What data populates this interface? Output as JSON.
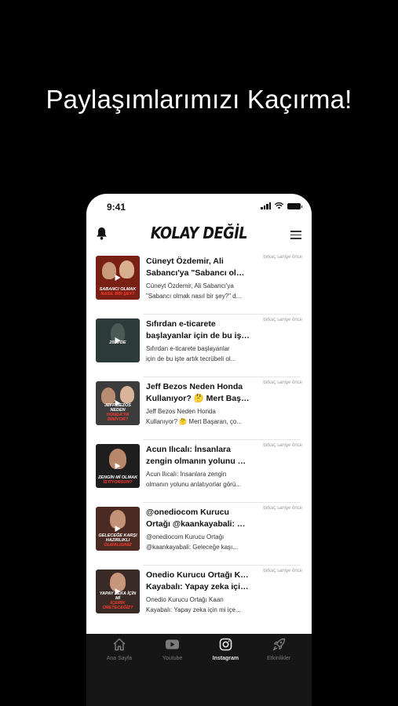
{
  "headline": "Paylaşımlarımızı Kaçırma!",
  "status": {
    "time": "9:41"
  },
  "app": {
    "logo": "KOLAY DEĞİL"
  },
  "icons": {
    "bell": "bell-icon",
    "menu": "hamburger-menu-icon"
  },
  "feed": [
    {
      "title1": "Cüneyt Özdemir, Ali",
      "title2": "Sabancı'ya \"Sabancı olma...",
      "desc1": "Cüneyt Özdemir, Ali Sabancı'ya",
      "desc2": "\"Sabancı olmak nasıl bir şey?\" d...",
      "time": "birkaç saniye önce",
      "caption": "SABANCI OLMAK",
      "caption2": "NASIL BİR ŞEY?",
      "bg": "#7a1f14"
    },
    {
      "title1": "Sıfırdan e-ticarete",
      "title2": "başlayanlar için de bu işte...",
      "desc1": "Sıfırdan e-ticarete başlayanlar",
      "desc2": "için de bu işte artık tecrübeli ol...",
      "time": "birkaç saniye önce",
      "caption": "2020'DE",
      "caption2": "",
      "bg": "#2c3a3a"
    },
    {
      "title1": "Jeff Bezos Neden Honda",
      "title2": "Kullanıyor? 🤔 Mert Başar...",
      "desc1": "Jeff Bezos Neden Honda",
      "desc2": "Kullanıyor? 🤔 Mert Başaran, ço...",
      "time": "birkaç saniye önce",
      "caption": "JEFF BEZOS NEDEN",
      "caption2": "HONDA'YA BİNİYOR?",
      "bg": "#3c3c3c"
    },
    {
      "title1": "Acun Ilıcalı: İnsanlara",
      "title2": "zengin olmanın yolunu anl...",
      "desc1": "Acun Ilıcalı: İnsanlara zengin",
      "desc2": "olmanın yolunu anlatıyorlar görü...",
      "time": "birkaç saniye önce",
      "caption": "ZENGİN Mİ OLMAK",
      "caption2": "İSTİYORSUN?",
      "bg": "#1e1e1e"
    },
    {
      "title1": "@onediocom Kurucu",
      "title2": "Ortağı @kaankayabali: Ge...",
      "desc1": "@onediocom Kurucu Ortağı",
      "desc2": "@kaankayabali: Geleceğe kaşı...",
      "time": "birkaç saniye önce",
      "caption": "GELECEĞE KARŞI HAZIRLIKLI",
      "caption2": "OLMALISINIZ",
      "bg": "#4a2a22"
    },
    {
      "title1": "Onedio Kurucu Ortağı Kaan",
      "title2": "Kayabalı: Yapay zeka için...",
      "desc1": "Onedio Kurucu Ortağı Kaan",
      "desc2": "Kayabalı: Yapay zeka için mi içe...",
      "time": "birkaç saniye önce",
      "caption": "YAPAY ZEKA İÇİN Mİ",
      "caption2": "İÇERİK ÜRETECEĞİZ?",
      "bg": "#3a2a26"
    }
  ],
  "tabs": [
    {
      "label": "Ana Sayfa",
      "icon": "home-icon"
    },
    {
      "label": "Youtube",
      "icon": "youtube-icon"
    },
    {
      "label": "Instagram",
      "icon": "instagram-icon"
    },
    {
      "label": "Etkinlikler",
      "icon": "rocket-icon"
    }
  ]
}
